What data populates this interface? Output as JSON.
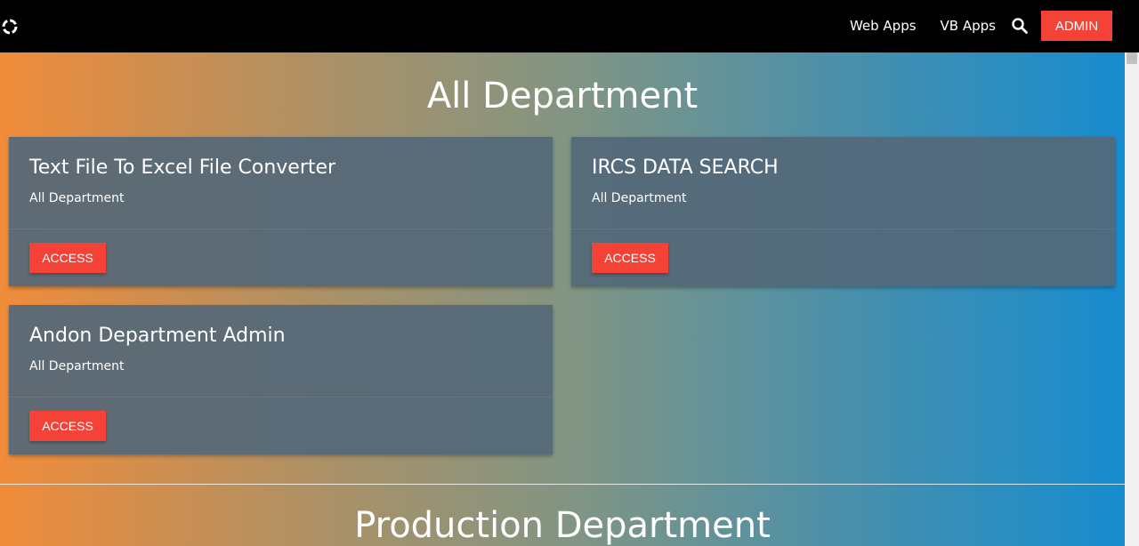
{
  "navbar": {
    "logo_icon": "ring-logo-icon",
    "links": [
      "Web Apps",
      "VB Apps"
    ],
    "search_icon": "search-icon",
    "admin_label": "ADMIN"
  },
  "sections": [
    {
      "title": "All Department",
      "cards": [
        {
          "title": "Text File To Excel File Converter",
          "subtitle": "All Department",
          "button": "ACCESS"
        },
        {
          "title": "IRCS DATA SEARCH",
          "subtitle": "All Department",
          "button": "ACCESS"
        },
        {
          "title": "Andon Department Admin",
          "subtitle": "All Department",
          "button": "ACCESS"
        }
      ]
    },
    {
      "title": "Production Department"
    }
  ],
  "colors": {
    "navbar": "#000000",
    "accent": "#f44336",
    "card": "#546879",
    "gradient_start": "#f08c3a",
    "gradient_end": "#168ccf"
  }
}
